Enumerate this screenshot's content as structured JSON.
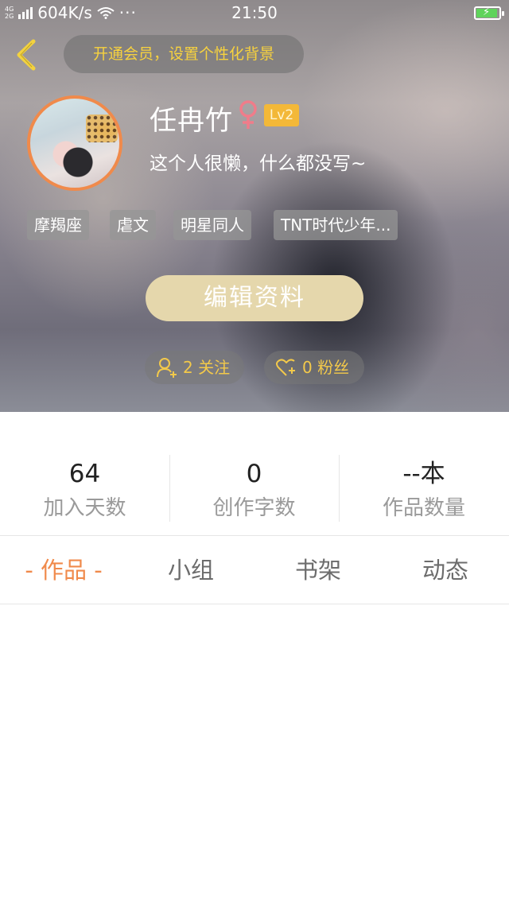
{
  "status_bar": {
    "network_top": "4G",
    "network_bottom": "2G",
    "speed": "604K/s",
    "more": "···",
    "time": "21:50"
  },
  "header": {
    "vip_prompt": "开通会员，设置个性化背景"
  },
  "profile": {
    "name": "任冉竹",
    "gender_icon": "female-icon",
    "level": "Lv2",
    "bio": "这个人很懒，什么都没写~",
    "tags": [
      "摩羯座",
      "虐文",
      "明星同人",
      "TNT时代少年..."
    ],
    "edit_button": "编辑资料",
    "follow_label": "2 关注",
    "fans_label": "0 粉丝"
  },
  "stats": [
    {
      "value": "64",
      "label": "加入天数"
    },
    {
      "value": "0",
      "label": "创作字数"
    },
    {
      "value": "--本",
      "label": "作品数量"
    }
  ],
  "tabs": {
    "works": "- 作品 -",
    "group": "小组",
    "bookshelf": "书架",
    "activity": "动态"
  },
  "colors": {
    "accent_orange": "#f08a4b",
    "vip_yellow": "#f7d23e",
    "level_badge": "#f3b838",
    "edit_button": "#e5d7ac"
  }
}
